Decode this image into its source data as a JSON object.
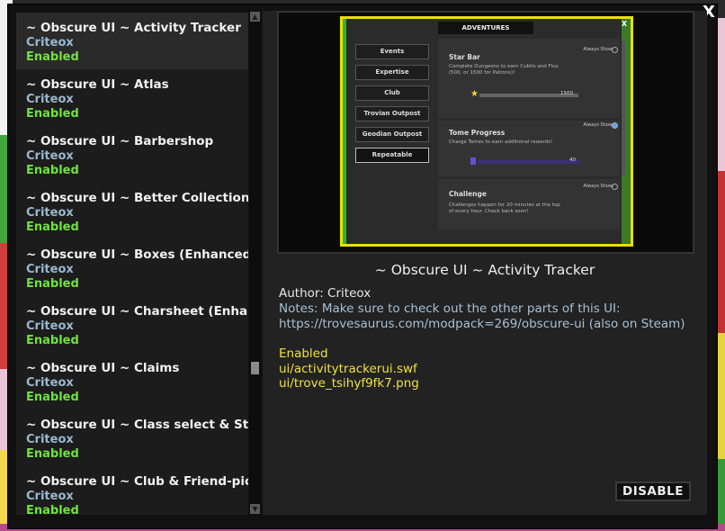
{
  "window": {
    "close_label": "X"
  },
  "mods": [
    {
      "title": "~ Obscure UI ~ Activity Tracker",
      "author": "Criteox",
      "status": "Enabled",
      "selected": true
    },
    {
      "title": "~ Obscure UI ~ Atlas",
      "author": "Criteox",
      "status": "Enabled"
    },
    {
      "title": "~ Obscure UI ~ Barbershop",
      "author": "Criteox",
      "status": "Enabled"
    },
    {
      "title": "~ Obscure UI ~ Better Collections",
      "author": "Criteox",
      "status": "Enabled"
    },
    {
      "title": "~ Obscure UI ~ Boxes (Enhanced UI)",
      "author": "Criteox",
      "status": "Enabled"
    },
    {
      "title": "~ Obscure UI ~ Charsheet (Enhanced UI)",
      "author": "Criteox",
      "status": "Enabled"
    },
    {
      "title": "~ Obscure UI ~ Claims",
      "author": "Criteox",
      "status": "Enabled"
    },
    {
      "title": "~ Obscure UI ~ Class select & Store (Quick)",
      "author": "Criteox",
      "status": "Enabled"
    },
    {
      "title": "~ Obscure UI ~ Club & Friend-picker",
      "author": "Criteox",
      "status": "Enabled"
    }
  ],
  "preview": {
    "window_title": "ADVENTURES",
    "close_label": "X",
    "tabs": [
      "Events",
      "Expertise",
      "Club",
      "Trovian Outpost",
      "Geodian Outpost",
      "Repeatable"
    ],
    "always_show": "Always Show",
    "sections": [
      {
        "title": "Star Bar",
        "desc": "Complete Dungeons to earn Cubits and Flux (500, or 1500 for Patrons)!",
        "value": "1500"
      },
      {
        "title": "Tome Progress",
        "desc": "Charge Tomes to earn additional rewards!",
        "value": "40"
      },
      {
        "title": "Challenge",
        "desc": "Challenges happen for 20 minutes at the top of every hour. Check back soon!"
      }
    ]
  },
  "detail": {
    "title": "~ Obscure UI ~ Activity Tracker",
    "author_line": "Author: Criteox",
    "notes_line1": "Notes: Make sure to check out the other parts of this UI:",
    "notes_line2": "https://trovesaurus.com/modpack=269/obscure-ui (also on Steam)",
    "status": "Enabled",
    "file1": "ui/activitytrackerui.swf",
    "file2": "ui/trove_tsihyf9fk7.png",
    "disable_label": "DISABLE"
  },
  "colors": {
    "author": "#9ab8cf",
    "enabled": "#6fe33b",
    "files": "#f0e23a",
    "notes": "#a7c0d4"
  }
}
